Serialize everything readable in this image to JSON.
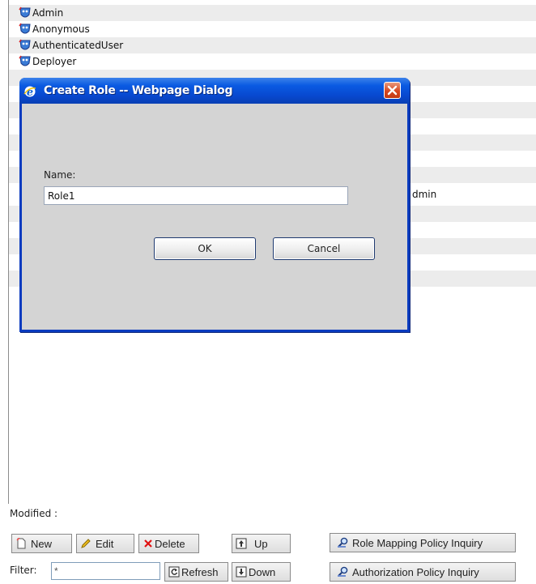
{
  "role_list": {
    "items": [
      {
        "label": "Admin"
      },
      {
        "label": "Anonymous"
      },
      {
        "label": "AuthenticatedUser"
      },
      {
        "label": "Deployer"
      }
    ],
    "partial_text": "dmin"
  },
  "dialog": {
    "title": "Create Role -- Webpage Dialog",
    "name_label": "Name:",
    "name_value": "Role1",
    "ok_label": "OK",
    "cancel_label": "Cancel"
  },
  "footer": {
    "modified_label": "Modified :",
    "new_label": "New",
    "edit_label": "Edit",
    "delete_label": "Delete",
    "up_label": "Up",
    "down_label": "Down",
    "refresh_label": "Refresh",
    "role_mapping_label": "Role Mapping Policy Inquiry",
    "authorization_label": "Authorization Policy Inquiry",
    "filter_label": "Filter:",
    "filter_value": "*"
  },
  "colors": {
    "titlebar": "#0a5ae2",
    "dialog_body": "#d4d4d4",
    "row_alt": "#ececec",
    "close_red": "#d6461f"
  }
}
